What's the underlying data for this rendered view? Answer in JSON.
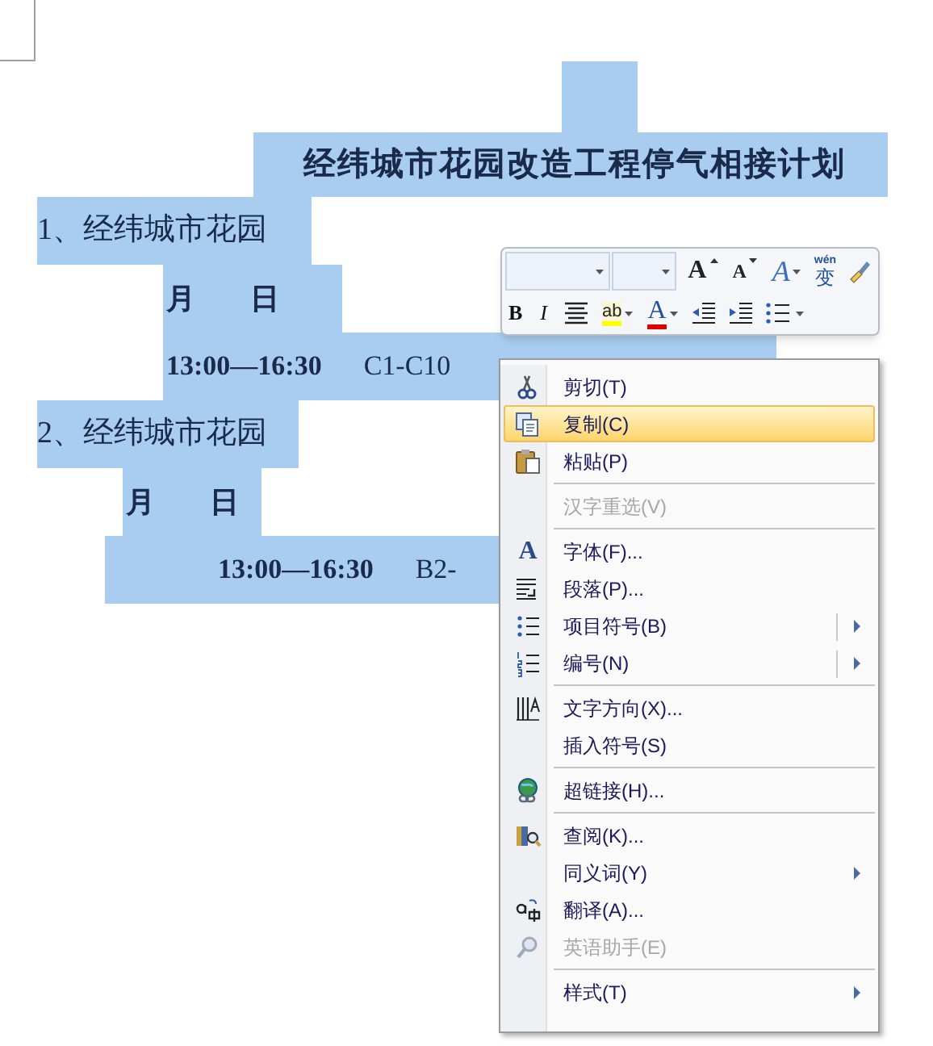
{
  "document": {
    "lines": [
      {
        "kind": "blank"
      },
      {
        "kind": "title",
        "text": "经纬城市花园改造工程停气相接计划"
      },
      {
        "kind": "heading",
        "text": "1、经纬城市花园"
      },
      {
        "kind": "date",
        "parts": [
          "月",
          "日"
        ]
      },
      {
        "kind": "time",
        "parts": [
          "13:00—16:30",
          "C1-C10"
        ]
      },
      {
        "kind": "heading",
        "text": "2、经纬城市花园"
      },
      {
        "kind": "date",
        "parts": [
          "月",
          "日"
        ]
      },
      {
        "kind": "time",
        "parts": [
          "13:00—16:30",
          "B2-"
        ]
      }
    ]
  },
  "mini_toolbar": {
    "rows": [
      [
        {
          "kind": "combo"
        },
        {
          "kind": "combo_small"
        },
        {
          "kind": "grow",
          "glyph": "A"
        },
        {
          "kind": "shrink",
          "glyph": "A"
        },
        {
          "kind": "style",
          "glyph": "A"
        },
        {
          "kind": "phonetic",
          "top": "wén",
          "glyph": "变"
        },
        {
          "kind": "icon"
        }
      ],
      [
        {
          "kind": "bold",
          "glyph": "B"
        },
        {
          "kind": "italic",
          "glyph": "I"
        },
        {
          "kind": "icon"
        },
        {
          "kind": "highlight",
          "glyph": "ab"
        },
        {
          "kind": "color",
          "glyph": "A"
        },
        {
          "kind": "icon"
        },
        {
          "kind": "icon"
        },
        {
          "kind": "icon"
        }
      ]
    ]
  },
  "context_menu": {
    "items": [
      {
        "kind": "item",
        "label": "剪切(T)",
        "selected": false,
        "disabled": false,
        "submenu": false
      },
      {
        "kind": "item",
        "label": "复制(C)",
        "selected": true,
        "disabled": false,
        "submenu": false
      },
      {
        "kind": "item",
        "label": "粘贴(P)",
        "selected": false,
        "disabled": false,
        "submenu": false
      },
      {
        "kind": "separator"
      },
      {
        "kind": "item",
        "label": "汉字重选(V)",
        "selected": false,
        "disabled": true,
        "submenu": false
      },
      {
        "kind": "separator"
      },
      {
        "kind": "item",
        "label": "字体(F)...",
        "selected": false,
        "disabled": false,
        "submenu": false,
        "glyph": "A"
      },
      {
        "kind": "item",
        "label": "段落(P)...",
        "selected": false,
        "disabled": false,
        "submenu": false
      },
      {
        "kind": "item",
        "label": "项目符号(B)",
        "selected": false,
        "disabled": false,
        "submenu": true,
        "split": true
      },
      {
        "kind": "item",
        "label": "编号(N)",
        "selected": false,
        "disabled": false,
        "submenu": true,
        "split": true
      },
      {
        "kind": "separator"
      },
      {
        "kind": "item",
        "label": "文字方向(X)...",
        "selected": false,
        "disabled": false,
        "submenu": false
      },
      {
        "kind": "item",
        "label": "插入符号(S)",
        "selected": false,
        "disabled": false,
        "submenu": false
      },
      {
        "kind": "separator"
      },
      {
        "kind": "item",
        "label": "超链接(H)...",
        "selected": false,
        "disabled": false,
        "submenu": false
      },
      {
        "kind": "separator"
      },
      {
        "kind": "item",
        "label": "查阅(K)...",
        "selected": false,
        "disabled": false,
        "submenu": false
      },
      {
        "kind": "item",
        "label": "同义词(Y)",
        "selected": false,
        "disabled": false,
        "submenu": true,
        "split": false
      },
      {
        "kind": "item",
        "label": "翻译(A)...",
        "selected": false,
        "disabled": false,
        "submenu": false
      },
      {
        "kind": "item",
        "label": "英语助手(E)",
        "selected": false,
        "disabled": true,
        "submenu": false
      },
      {
        "kind": "separator"
      },
      {
        "kind": "item",
        "label": "样式(T)",
        "selected": false,
        "disabled": false,
        "submenu": true,
        "split": false
      }
    ]
  }
}
